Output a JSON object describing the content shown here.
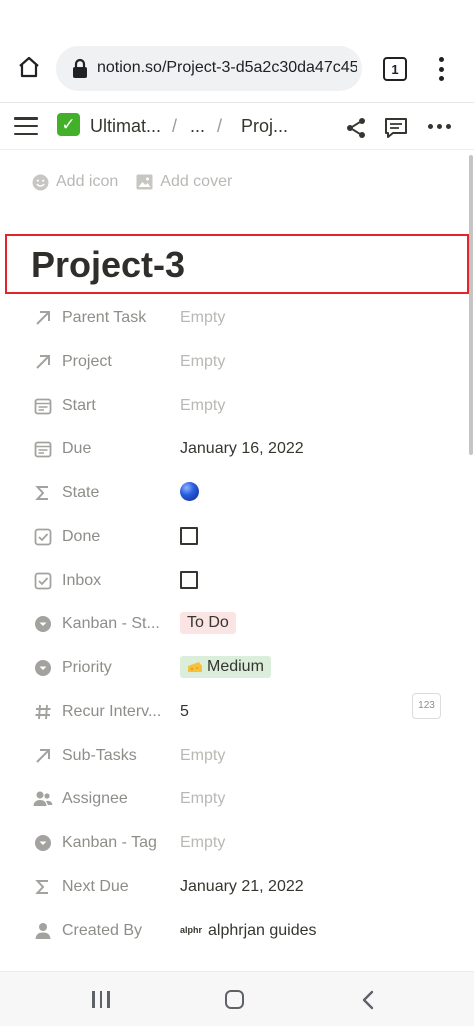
{
  "browser": {
    "url": "notion.so/Project-3-d5a2c30da47c450",
    "tab_count": "1",
    "icons": [
      "home-icon",
      "lock-icon",
      "tabs-icon",
      "more-vert-icon"
    ]
  },
  "topbar": {
    "breadcrumbs": [
      "Ultimat...",
      "...",
      "Proj..."
    ],
    "separator": "/",
    "icons": [
      "menu-icon",
      "check-icon",
      "share-icon",
      "comment-icon",
      "more-horiz-icon"
    ]
  },
  "page": {
    "add_icon_label": "Add icon",
    "add_cover_label": "Add cover",
    "title": "Project-3",
    "title_highlight_color": "#e0262b"
  },
  "properties": [
    {
      "label": "Parent Task",
      "value": "Empty",
      "icon": "arrow-up-right-icon",
      "kind": "empty"
    },
    {
      "label": "Project",
      "value": "Empty",
      "icon": "arrow-up-right-icon",
      "kind": "empty"
    },
    {
      "label": "Start",
      "value": "Empty",
      "icon": "calendar-icon",
      "kind": "empty"
    },
    {
      "label": "Due",
      "value": "January 16, 2022",
      "icon": "calendar-icon",
      "kind": "text"
    },
    {
      "label": "State",
      "value": "",
      "icon": "sigma-icon",
      "kind": "ball"
    },
    {
      "label": "Done",
      "value": "",
      "icon": "checkbox-icon",
      "kind": "checkbox"
    },
    {
      "label": "Inbox",
      "value": "",
      "icon": "checkbox-icon",
      "kind": "checkbox"
    },
    {
      "label": "Kanban - St...",
      "value": "To Do",
      "icon": "select-icon",
      "kind": "tag-todo"
    },
    {
      "label": "Priority",
      "value": "Medium",
      "icon": "select-icon",
      "kind": "tag-medium"
    },
    {
      "label": "Recur Interv...",
      "value": "5",
      "icon": "hash-icon",
      "kind": "number",
      "badge": "123"
    },
    {
      "label": "Sub-Tasks",
      "value": "Empty",
      "icon": "arrow-up-right-icon",
      "kind": "empty"
    },
    {
      "label": "Assignee",
      "value": "Empty",
      "icon": "people-icon",
      "kind": "empty"
    },
    {
      "label": "Kanban - Tag",
      "value": "Empty",
      "icon": "select-icon",
      "kind": "empty"
    },
    {
      "label": "Next Due",
      "value": "January 21, 2022",
      "icon": "sigma-icon",
      "kind": "text"
    },
    {
      "label": "Created By",
      "value": "alphrjan guides",
      "icon": "person-icon",
      "kind": "creator",
      "logo": "alphr"
    }
  ],
  "colors": {
    "todo_tag_bg": "#fbe4e4",
    "medium_tag_bg": "#dbeddb",
    "label_gray": "#8e8d89",
    "empty_gray": "#b9b8b5"
  },
  "navbar": {
    "icons": [
      "recent-apps-icon",
      "home-nav-icon",
      "back-icon"
    ]
  }
}
